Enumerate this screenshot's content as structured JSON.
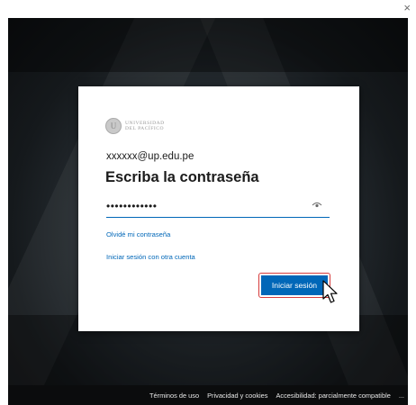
{
  "window": {
    "close_label": "×"
  },
  "logo": {
    "seal_letter": "U",
    "line1": "UNIVERSIDAD",
    "line2": "DEL PACÍFICO"
  },
  "login": {
    "email": "xxxxxx@up.edu.pe",
    "heading": "Escriba la contraseña",
    "password_masked": "••••••••••••",
    "forgot_link": "Olvidé mi contraseña",
    "other_account_link": "Iniciar sesión con otra cuenta",
    "submit_label": "Iniciar sesión"
  },
  "footer": {
    "links": [
      "Términos de uso",
      "Privacidad y cookies",
      "Accesibilidad: parcialmente compatible",
      "..."
    ]
  },
  "colors": {
    "accent": "#0067b8",
    "highlight": "#d63c3c"
  },
  "icons": {
    "close": "close-icon",
    "reveal": "eye-icon",
    "pointer": "mouse-pointer-icon"
  }
}
